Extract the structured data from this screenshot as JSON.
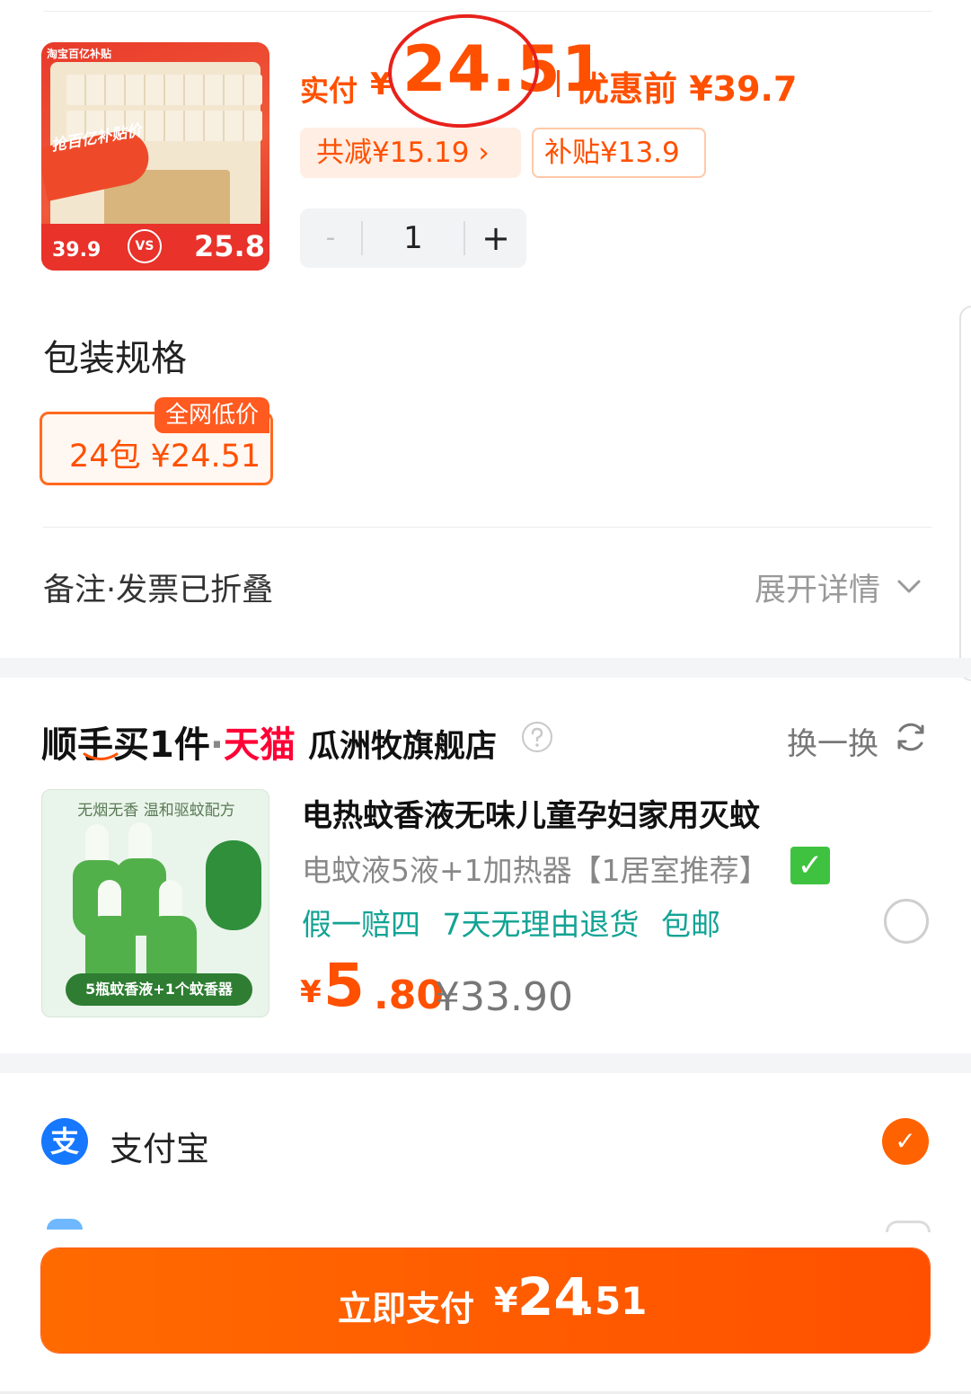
{
  "product": {
    "image_banner": "淘宝百亿补贴",
    "image_slogan": "抢百亿补贴价",
    "image_old_price": "39.9",
    "image_vs": "VS",
    "image_new_price": "25.8",
    "pay_label": "实付",
    "currency": "¥",
    "pay_amount": "24.51",
    "before_discount": "优惠前 ¥39.7",
    "reduce_chip": "共减¥15.19 ›",
    "subsidy_chip": "补贴¥13.9",
    "quantity": "1",
    "minus": "-",
    "plus": "+"
  },
  "spec": {
    "title": "包装规格",
    "option_label": "24包  ¥24.51",
    "option_tag": "全网低价"
  },
  "remark": {
    "label": "备注·发票已折叠",
    "expand": "展开详情"
  },
  "bundle": {
    "title_prefix": "顺手买1件",
    "dot": "·",
    "platform": "天猫",
    "shop": "瓜洲牧旗舰店",
    "swap": "换一换",
    "item": {
      "image_top_text": "无烟无香 温和驱蚊配方",
      "image_strip_text": "5瓶蚊香液+1个蚊香器",
      "name": "电热蚊香液无味儿童孕妇家用灭蚊",
      "spec": "电蚊液5液+1加热器【1居室推荐】",
      "tags": "假一赔四 7天无理由退货 包邮",
      "price_yen": "¥",
      "price_int": "5",
      "price_dec": ".80",
      "original_price": "¥33.90"
    }
  },
  "payment": {
    "method": "支付宝",
    "method_icon_glyph": "支"
  },
  "pay_button": {
    "label": "立即支付",
    "yen": "¥",
    "int": "24",
    "dec": ".51"
  },
  "colors": {
    "accent": "#ff5000",
    "tmall": "#ff0036",
    "alipay": "#1677ff",
    "tag_green": "#12a394"
  }
}
